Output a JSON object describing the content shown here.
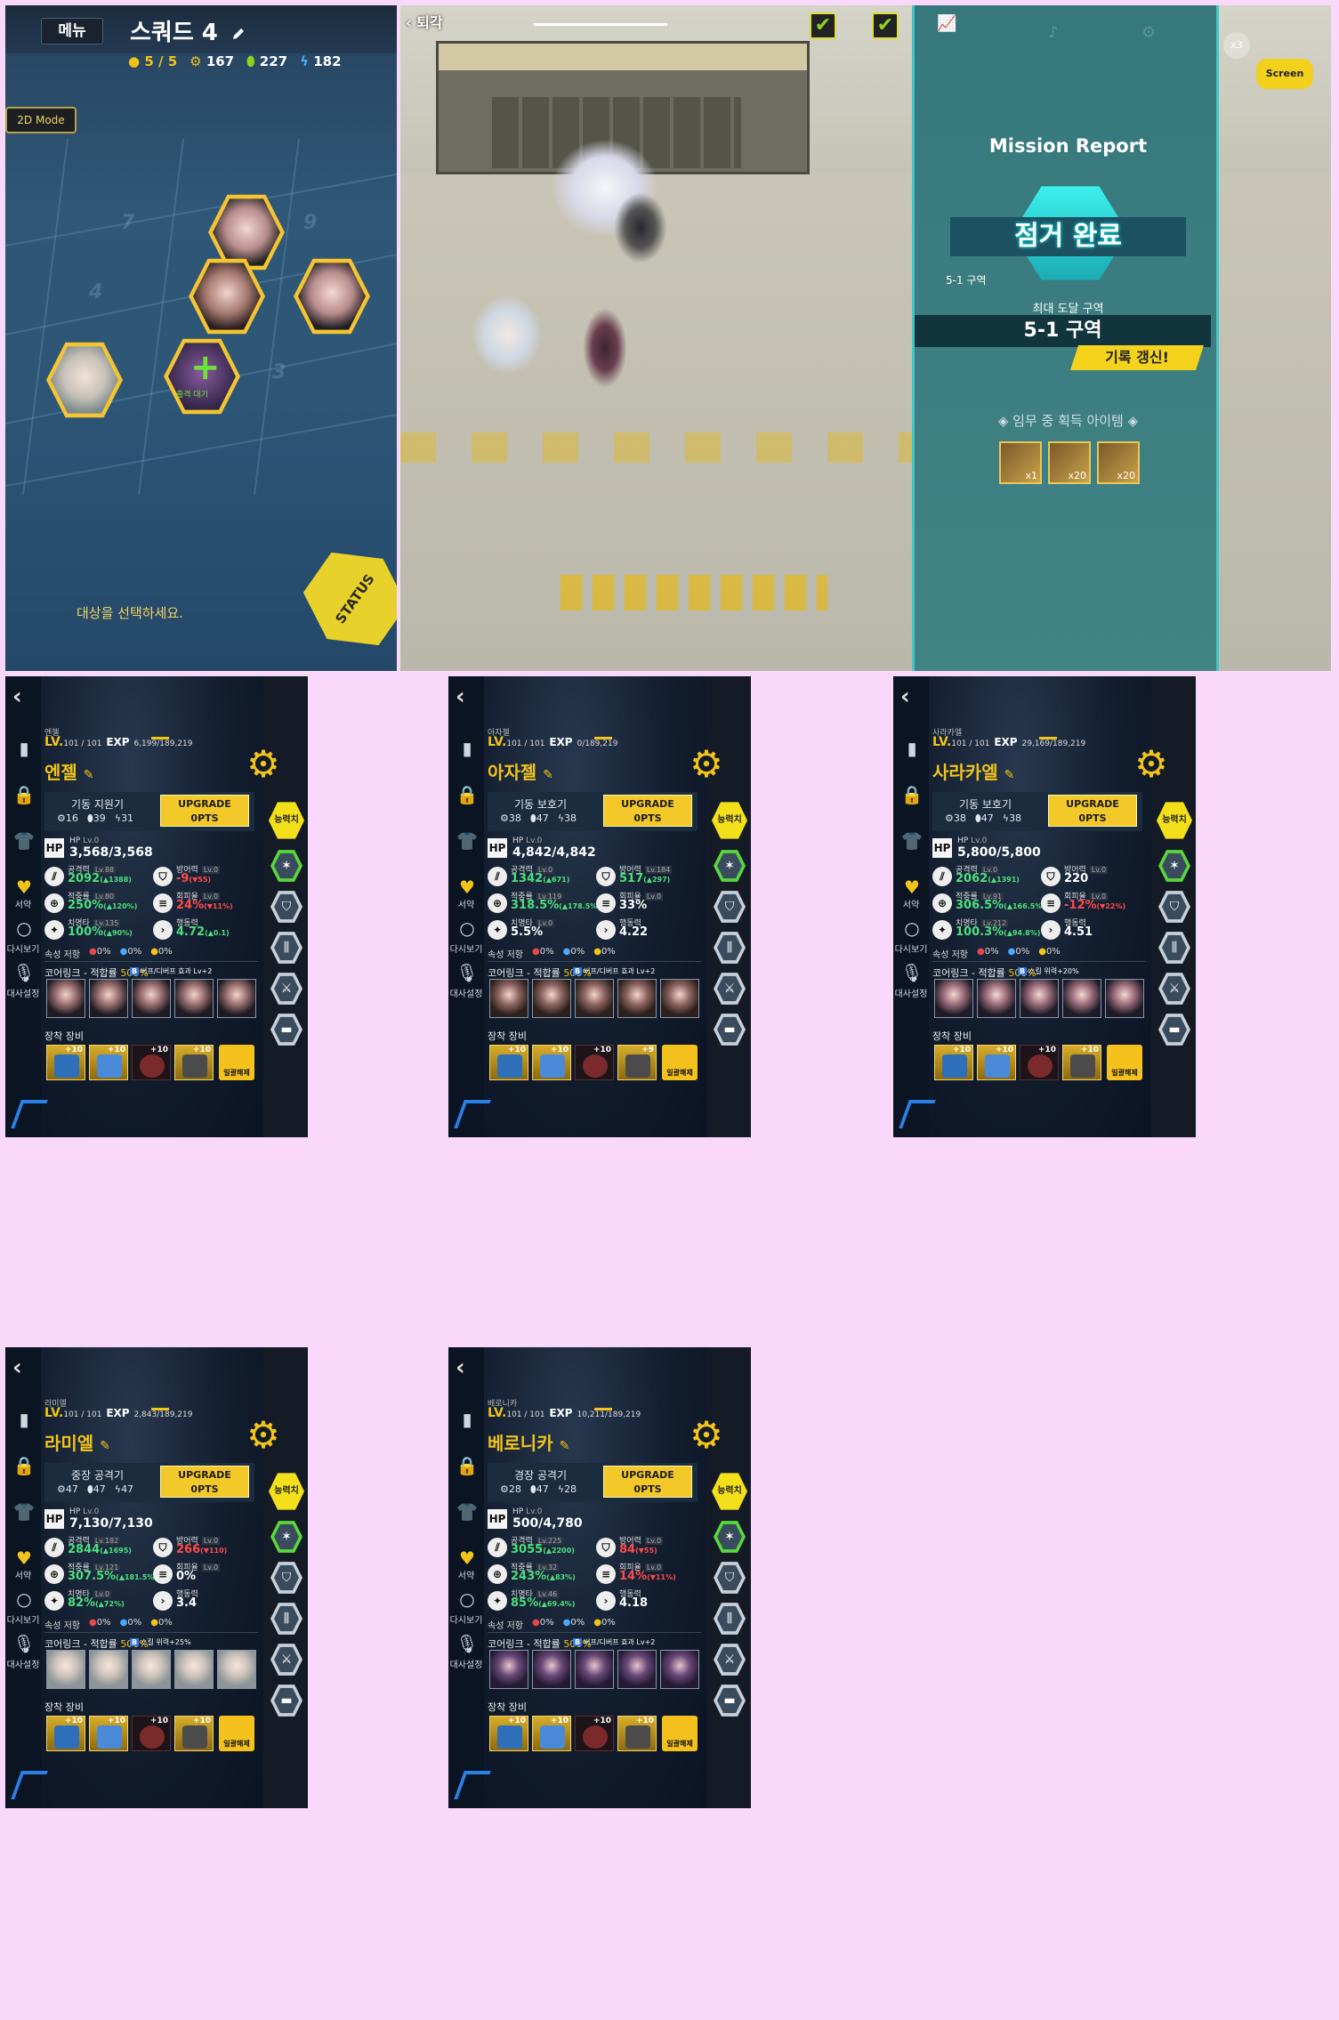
{
  "squad": {
    "menu_label": "메뉴",
    "title": "스쿼드 4",
    "members": "5 / 5",
    "stat_a": "167",
    "stat_b": "227",
    "stat_c": "182",
    "mode_button": "2D Mode",
    "grid_numbers": [
      "7",
      "9",
      "4",
      "3"
    ],
    "hint": "대상을 선택하세요.",
    "status_button": "STATUS",
    "center_tag": "출격 대기"
  },
  "battle": {
    "retreat_label": "퇴각",
    "screen_label": "Screen",
    "speed_badge": "x3"
  },
  "report": {
    "title": "Mission Report",
    "status": "점거 완료",
    "zone_small": "5-1 구역",
    "max_zone_label": "최대 도달 구역",
    "max_zone": "5-1 구역",
    "new_record": "기록 갱신!",
    "loot_title": "임무 중 획득 아이템",
    "loot": [
      "x1",
      "x20",
      "x20"
    ]
  },
  "characters": [
    {
      "name_small": "엔젤",
      "level": "LV.",
      "level_num": "101 / 101",
      "exp_label": "EXP",
      "exp": "6,199/189,219",
      "name": "엔젤",
      "class": "기동 지원기",
      "class_stats": [
        "16",
        "39",
        "31"
      ],
      "upgrade": "UPGRADE",
      "pts": "0PTS",
      "hp_label": "HP",
      "hp_lv": "Lv.0",
      "hp": "3,568/3,568",
      "atk_label": "공격력",
      "atk_lv": "Lv.88",
      "atk": "2092",
      "atk_mod": "(▲1388)",
      "def_label": "방어력",
      "def_lv": "Lv.0",
      "def": "-9",
      "def_mod": "(▼55)",
      "acc_label": "적중률",
      "acc_lv": "Lv.80",
      "acc": "250%",
      "acc_mod": "(▲120%)",
      "eva_label": "회피율",
      "eva_lv": "Lv.0",
      "eva": "24%",
      "eva_mod": "(▼11%)",
      "crit_label": "치명타",
      "crit_lv": "Lv.135",
      "crit": "100%",
      "crit_mod": "(▲90%)",
      "spd_label": "행동력",
      "spd": "4.72",
      "spd_mod": "(▲0.1)",
      "res_label": "속성 저항",
      "res": [
        "0%",
        "0%",
        "0%"
      ],
      "core_label": "코어링크 - 적합률",
      "core_rate": "500%",
      "core_bonus": "버프/디버프 효과 Lv+2",
      "equip_label": "장착 장비",
      "equips": [
        "+10",
        "+10",
        "+10",
        "+10"
      ],
      "unequip": "일괄해제",
      "side": [
        "서약",
        "다시보기",
        "대사설정"
      ],
      "ability": "능력치"
    },
    {
      "name_small": "아자젤",
      "level": "LV.",
      "level_num": "101 / 101",
      "exp_label": "EXP",
      "exp": "0/189,219",
      "name": "아자젤",
      "class": "기동 보호기",
      "class_stats": [
        "38",
        "47",
        "38"
      ],
      "upgrade": "UPGRADE",
      "pts": "0PTS",
      "hp_label": "HP",
      "hp_lv": "Lv.0",
      "hp": "4,842/4,842",
      "atk_label": "공격력",
      "atk_lv": "Lv.0",
      "atk": "1342",
      "atk_mod": "(▲671)",
      "def_label": "방어력",
      "def_lv": "Lv.184",
      "def": "517",
      "def_mod": "(▲297)",
      "acc_label": "적중률",
      "acc_lv": "Lv.119",
      "acc": "318.5%",
      "acc_mod": "(▲178.5%)",
      "eva_label": "회피율",
      "eva_lv": "Lv.0",
      "eva": "33%",
      "eva_mod": "",
      "crit_label": "치명타",
      "crit_lv": "Lv.0",
      "crit": "5.5%",
      "crit_mod": "",
      "spd_label": "행동력",
      "spd": "4.22",
      "spd_mod": "",
      "res_label": "속성 저항",
      "res": [
        "0%",
        "0%",
        "0%"
      ],
      "core_label": "코어링크 - 적합률",
      "core_rate": "500%",
      "core_bonus": "버프/디버프 효과 Lv+2",
      "equip_label": "장착 장비",
      "equips": [
        "+10",
        "+10",
        "+10",
        "+9"
      ],
      "unequip": "일괄해제",
      "side": [
        "서약",
        "다시보기",
        "대사설정"
      ],
      "ability": "능력치"
    },
    {
      "name_small": "사라카엘",
      "level": "LV.",
      "level_num": "101 / 101",
      "exp_label": "EXP",
      "exp": "29,169/189,219",
      "name": "사라카엘",
      "class": "기동 보호기",
      "class_stats": [
        "38",
        "47",
        "38"
      ],
      "upgrade": "UPGRADE",
      "pts": "0PTS",
      "hp_label": "HP",
      "hp_lv": "Lv.0",
      "hp": "5,800/5,800",
      "atk_label": "공격력",
      "atk_lv": "Lv.0",
      "atk": "2062",
      "atk_mod": "(▲1391)",
      "def_label": "방어력",
      "def_lv": "Lv.0",
      "def": "220",
      "def_mod": "",
      "acc_label": "적중률",
      "acc_lv": "Lv.91",
      "acc": "306.5%",
      "acc_mod": "(▲166.5%)",
      "eva_label": "회피율",
      "eva_lv": "Lv.0",
      "eva": "-12%",
      "eva_mod": "(▼22%)",
      "crit_label": "치명타",
      "crit_lv": "Lv.212",
      "crit": "100.3%",
      "crit_mod": "(▲94.8%)",
      "spd_label": "행동력",
      "spd": "4.51",
      "spd_mod": "",
      "res_label": "속성 저항",
      "res": [
        "0%",
        "0%",
        "0%"
      ],
      "core_label": "코어링크 - 적합률",
      "core_rate": "500%",
      "core_bonus": "스킬 위력+20%",
      "equip_label": "장착 장비",
      "equips": [
        "+10",
        "+10",
        "+10",
        "+10"
      ],
      "unequip": "일괄해제",
      "side": [
        "서약",
        "다시보기",
        "대사설정"
      ],
      "ability": "능력치"
    },
    {
      "name_small": "라미엘",
      "level": "LV.",
      "level_num": "101 / 101",
      "exp_label": "EXP",
      "exp": "2,843/189,219",
      "name": "라미엘",
      "class": "중장 공격기",
      "class_stats": [
        "47",
        "47",
        "47"
      ],
      "upgrade": "UPGRADE",
      "pts": "0PTS",
      "hp_label": "HP",
      "hp_lv": "Lv.0",
      "hp": "7,130/7,130",
      "atk_label": "공격력",
      "atk_lv": "Lv.182",
      "atk": "2844",
      "atk_mod": "(▲1695)",
      "def_label": "방어력",
      "def_lv": "Lv.0",
      "def": "266",
      "def_mod": "(▼110)",
      "acc_label": "적중률",
      "acc_lv": "Lv.121",
      "acc": "307.5%",
      "acc_mod": "(▲181.5%)",
      "eva_label": "회피율",
      "eva_lv": "Lv.0",
      "eva": "0%",
      "eva_mod": "",
      "crit_label": "치명타",
      "crit_lv": "Lv.0",
      "crit": "82%",
      "crit_mod": "(▲72%)",
      "spd_label": "행동력",
      "spd": "3.4",
      "spd_mod": "",
      "res_label": "속성 저항",
      "res": [
        "0%",
        "0%",
        "0%"
      ],
      "core_label": "코어링크 - 적합률",
      "core_rate": "500%",
      "core_bonus": "스킬 위력+25%",
      "equip_label": "장착 장비",
      "equips": [
        "+10",
        "+10",
        "+10",
        "+10"
      ],
      "unequip": "일괄해제",
      "side": [
        "서약",
        "다시보기",
        "대사설정"
      ],
      "ability": "능력치"
    },
    {
      "name_small": "베로니카",
      "level": "LV.",
      "level_num": "101 / 101",
      "exp_label": "EXP",
      "exp": "10,211/189,219",
      "name": "베로니카",
      "class": "경장 공격기",
      "class_stats": [
        "28",
        "47",
        "28"
      ],
      "upgrade": "UPGRADE",
      "pts": "0PTS",
      "hp_label": "HP",
      "hp_lv": "Lv.0",
      "hp": "500/4,780",
      "atk_label": "공격력",
      "atk_lv": "Lv.225",
      "atk": "3055",
      "atk_mod": "(▲2200)",
      "def_label": "방어력",
      "def_lv": "Lv.0",
      "def": "84",
      "def_mod": "(▼55)",
      "acc_label": "적중률",
      "acc_lv": "Lv.32",
      "acc": "243%",
      "acc_mod": "(▲83%)",
      "eva_label": "회피율",
      "eva_lv": "Lv.0",
      "eva": "14%",
      "eva_mod": "(▼11%)",
      "crit_label": "치명타",
      "crit_lv": "Lv.46",
      "crit": "85%",
      "crit_mod": "(▲69.4%)",
      "spd_label": "행동력",
      "spd": "4.18",
      "spd_mod": "",
      "res_label": "속성 저항",
      "res": [
        "0%",
        "0%",
        "0%"
      ],
      "core_label": "코어링크 - 적합률",
      "core_rate": "500%",
      "core_bonus": "버프/디버프 효과 Lv+2",
      "equip_label": "장착 장비",
      "equips": [
        "+10",
        "+10",
        "+10",
        "+10"
      ],
      "unequip": "일괄해제",
      "side": [
        "서약",
        "다시보기",
        "대사설정"
      ],
      "ability": "능력치"
    }
  ],
  "colors": {
    "accent_yellow": "#f2c419",
    "stat_up": "#4be07c",
    "stat_down": "#ff4a4a",
    "report_teal": "#2d7a7f",
    "background_pink": "#f9d8fc"
  }
}
